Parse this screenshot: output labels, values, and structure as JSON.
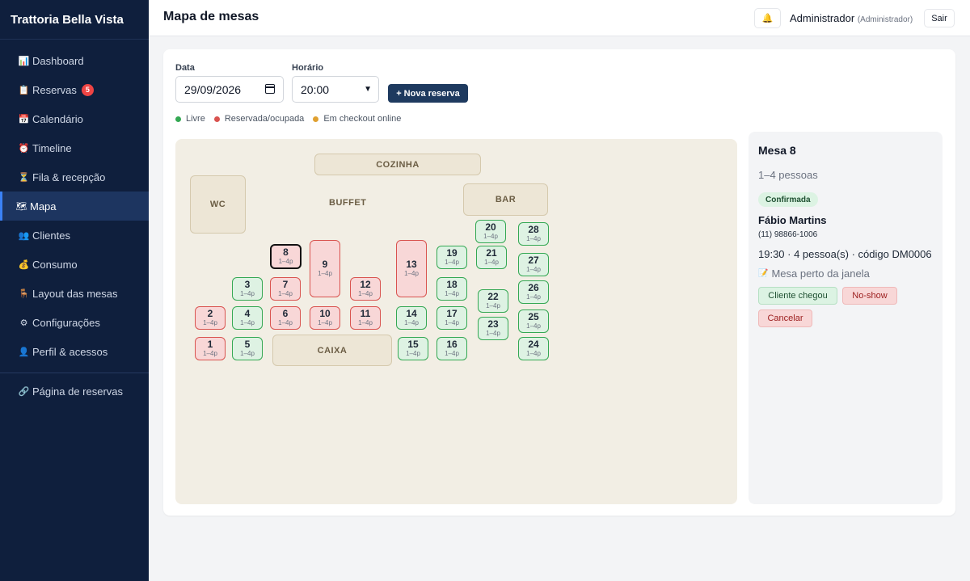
{
  "app": {
    "brand": "Trattoria Bella Vista",
    "page_title": "Mapa de mesas",
    "user_name": "Administrador",
    "user_role": "(Administrador)",
    "logout_label": "Sair",
    "bell_icon": "bell-icon"
  },
  "sidebar": {
    "items": [
      {
        "key": "dashboard",
        "icon": "📊",
        "label": "Dashboard",
        "active": false
      },
      {
        "key": "reservas",
        "icon": "📋",
        "label": "Reservas",
        "badge": "5",
        "active": false
      },
      {
        "key": "calendario",
        "icon": "📅",
        "label": "Calendário",
        "active": false
      },
      {
        "key": "timeline",
        "icon": "⏰",
        "label": "Timeline",
        "active": false
      },
      {
        "key": "fila",
        "icon": "⏳",
        "label": "Fila & recepção",
        "active": false
      },
      {
        "key": "mapa",
        "icon": "🗺",
        "label": "Mapa",
        "active": true
      },
      {
        "key": "clientes",
        "icon": "👥",
        "label": "Clientes",
        "active": false
      },
      {
        "key": "consumo",
        "icon": "💰",
        "label": "Consumo",
        "active": false
      },
      {
        "key": "layout",
        "icon": "🪑",
        "label": "Layout das mesas",
        "active": false
      },
      {
        "key": "config",
        "icon": "⚙",
        "label": "Configurações",
        "active": false
      },
      {
        "key": "perfil",
        "icon": "👤",
        "label": "Perfil & acessos",
        "active": false
      }
    ],
    "footer_item": {
      "key": "pagina",
      "icon": "🔗",
      "label": "Página de reservas"
    }
  },
  "filters": {
    "date_label": "Data",
    "date_value": "29/09/2026",
    "time_label": "Horário",
    "time_value": "20:00",
    "new_button": "+ Nova reserva"
  },
  "legend": [
    {
      "label": "Livre",
      "color": "#34a853"
    },
    {
      "label": "Reservada/ocupada",
      "color": "#d9534f"
    },
    {
      "label": "Em checkout online",
      "color": "#e0a030"
    }
  ],
  "floor": {
    "zones": {
      "cozinha": "COZINHA",
      "wc": "WC",
      "buffet": "BUFFET",
      "bar": "BAR",
      "caixa": "CAIXA"
    },
    "capacity_label": "1–4p",
    "tables": [
      {
        "num": "1",
        "status": "busy"
      },
      {
        "num": "2",
        "status": "busy"
      },
      {
        "num": "3",
        "status": "free"
      },
      {
        "num": "4",
        "status": "free"
      },
      {
        "num": "5",
        "status": "free"
      },
      {
        "num": "6",
        "status": "busy"
      },
      {
        "num": "7",
        "status": "busy"
      },
      {
        "num": "8",
        "status": "busy",
        "selected": true
      },
      {
        "num": "9",
        "status": "busy"
      },
      {
        "num": "10",
        "status": "busy"
      },
      {
        "num": "11",
        "status": "busy"
      },
      {
        "num": "12",
        "status": "busy"
      },
      {
        "num": "13",
        "status": "busy"
      },
      {
        "num": "14",
        "status": "free"
      },
      {
        "num": "15",
        "status": "free"
      },
      {
        "num": "16",
        "status": "free"
      },
      {
        "num": "17",
        "status": "free"
      },
      {
        "num": "18",
        "status": "free"
      },
      {
        "num": "19",
        "status": "free"
      },
      {
        "num": "20",
        "status": "free"
      },
      {
        "num": "21",
        "status": "free"
      },
      {
        "num": "22",
        "status": "free"
      },
      {
        "num": "23",
        "status": "free"
      },
      {
        "num": "24",
        "status": "free"
      },
      {
        "num": "25",
        "status": "free"
      },
      {
        "num": "26",
        "status": "free"
      },
      {
        "num": "27",
        "status": "free"
      },
      {
        "num": "28",
        "status": "free"
      }
    ]
  },
  "detail": {
    "title": "Mesa 8",
    "capacity": "1–4 pessoas",
    "status": "Confirmada",
    "guest_name": "Fábio Martins",
    "phone": "(11) 98866-1006",
    "info": "19:30 · 4 pessoa(s) · código DM0006",
    "note_icon": "📝",
    "note": "Mesa perto da janela",
    "btn_arrived": "Cliente chegou",
    "btn_noshow": "No-show",
    "btn_cancel": "Cancelar"
  }
}
